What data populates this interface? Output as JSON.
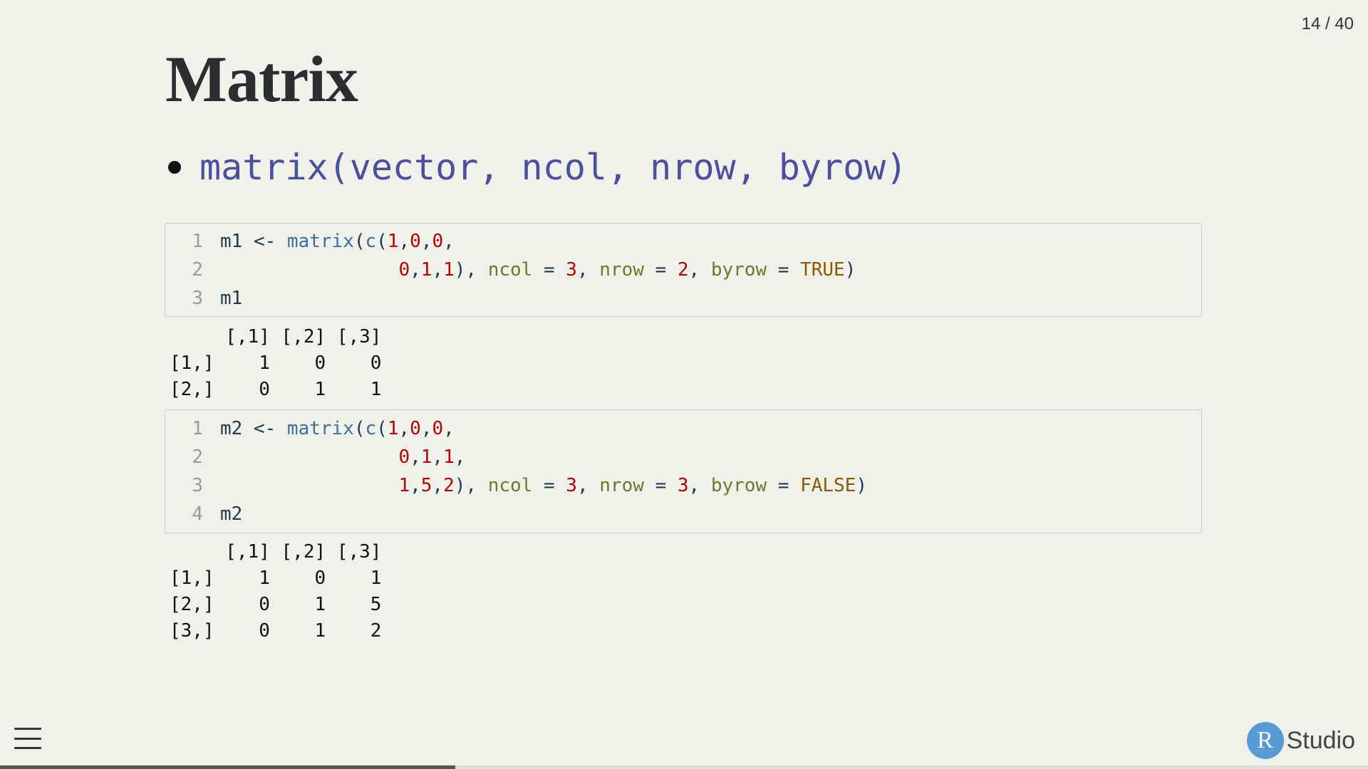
{
  "slide": {
    "counter": "14 / 40",
    "title": "Matrix",
    "bullet": "matrix(vector, ncol, nrow, byrow)"
  },
  "code_block_1": {
    "lines": [
      {
        "n": "1",
        "tokens": [
          [
            "plain",
            "m1 <- "
          ],
          [
            "fn",
            "matrix"
          ],
          [
            "punc",
            "("
          ],
          [
            "fn",
            "c"
          ],
          [
            "punc",
            "("
          ],
          [
            "num",
            "1"
          ],
          [
            "punc",
            ","
          ],
          [
            "num",
            "0"
          ],
          [
            "punc",
            ","
          ],
          [
            "num",
            "0"
          ],
          [
            "punc",
            ","
          ]
        ]
      },
      {
        "n": "2",
        "tokens": [
          [
            "plain",
            "                "
          ],
          [
            "num",
            "0"
          ],
          [
            "punc",
            ","
          ],
          [
            "num",
            "1"
          ],
          [
            "punc",
            ","
          ],
          [
            "num",
            "1"
          ],
          [
            "punc",
            "), "
          ],
          [
            "arg",
            "ncol"
          ],
          [
            "punc",
            " = "
          ],
          [
            "num",
            "3"
          ],
          [
            "punc",
            ", "
          ],
          [
            "arg",
            "nrow"
          ],
          [
            "punc",
            " = "
          ],
          [
            "num",
            "2"
          ],
          [
            "punc",
            ", "
          ],
          [
            "arg",
            "byrow"
          ],
          [
            "punc",
            " = "
          ],
          [
            "kw",
            "TRUE"
          ],
          [
            "punc",
            ")"
          ]
        ]
      },
      {
        "n": "3",
        "tokens": [
          [
            "plain",
            "m1"
          ]
        ]
      }
    ]
  },
  "output_1": "     [,1] [,2] [,3]\n[1,]    1    0    0\n[2,]    0    1    1",
  "code_block_2": {
    "lines": [
      {
        "n": "1",
        "tokens": [
          [
            "plain",
            "m2 <- "
          ],
          [
            "fn",
            "matrix"
          ],
          [
            "punc",
            "("
          ],
          [
            "fn",
            "c"
          ],
          [
            "punc",
            "("
          ],
          [
            "num",
            "1"
          ],
          [
            "punc",
            ","
          ],
          [
            "num",
            "0"
          ],
          [
            "punc",
            ","
          ],
          [
            "num",
            "0"
          ],
          [
            "punc",
            ","
          ]
        ]
      },
      {
        "n": "2",
        "tokens": [
          [
            "plain",
            "                "
          ],
          [
            "num",
            "0"
          ],
          [
            "punc",
            ","
          ],
          [
            "num",
            "1"
          ],
          [
            "punc",
            ","
          ],
          [
            "num",
            "1"
          ],
          [
            "punc",
            ","
          ]
        ]
      },
      {
        "n": "3",
        "tokens": [
          [
            "plain",
            "                "
          ],
          [
            "num",
            "1"
          ],
          [
            "punc",
            ","
          ],
          [
            "num",
            "5"
          ],
          [
            "punc",
            ","
          ],
          [
            "num",
            "2"
          ],
          [
            "punc",
            "), "
          ],
          [
            "arg",
            "ncol"
          ],
          [
            "punc",
            " = "
          ],
          [
            "num",
            "3"
          ],
          [
            "punc",
            ", "
          ],
          [
            "arg",
            "nrow"
          ],
          [
            "punc",
            " = "
          ],
          [
            "num",
            "3"
          ],
          [
            "punc",
            ", "
          ],
          [
            "arg",
            "byrow"
          ],
          [
            "punc",
            " = "
          ],
          [
            "kw",
            "FALSE"
          ],
          [
            "punc",
            ")"
          ]
        ]
      },
      {
        "n": "4",
        "tokens": [
          [
            "plain",
            "m2"
          ]
        ]
      }
    ]
  },
  "output_2": "     [,1] [,2] [,3]\n[1,]    1    0    1\n[2,]    0    1    5\n[3,]    0    1    2",
  "footer": {
    "menu_icon": "hamburger-menu-icon",
    "logo_letter": "R",
    "logo_text": "Studio",
    "progress": 0.333
  },
  "colors": {
    "background": "#f0f1eb",
    "bullet_code": "#4a4f9e",
    "number": "#b30000",
    "argument": "#6b7a2a",
    "keyword": "#8a5a00",
    "logo_circle": "#5b9bd5"
  }
}
